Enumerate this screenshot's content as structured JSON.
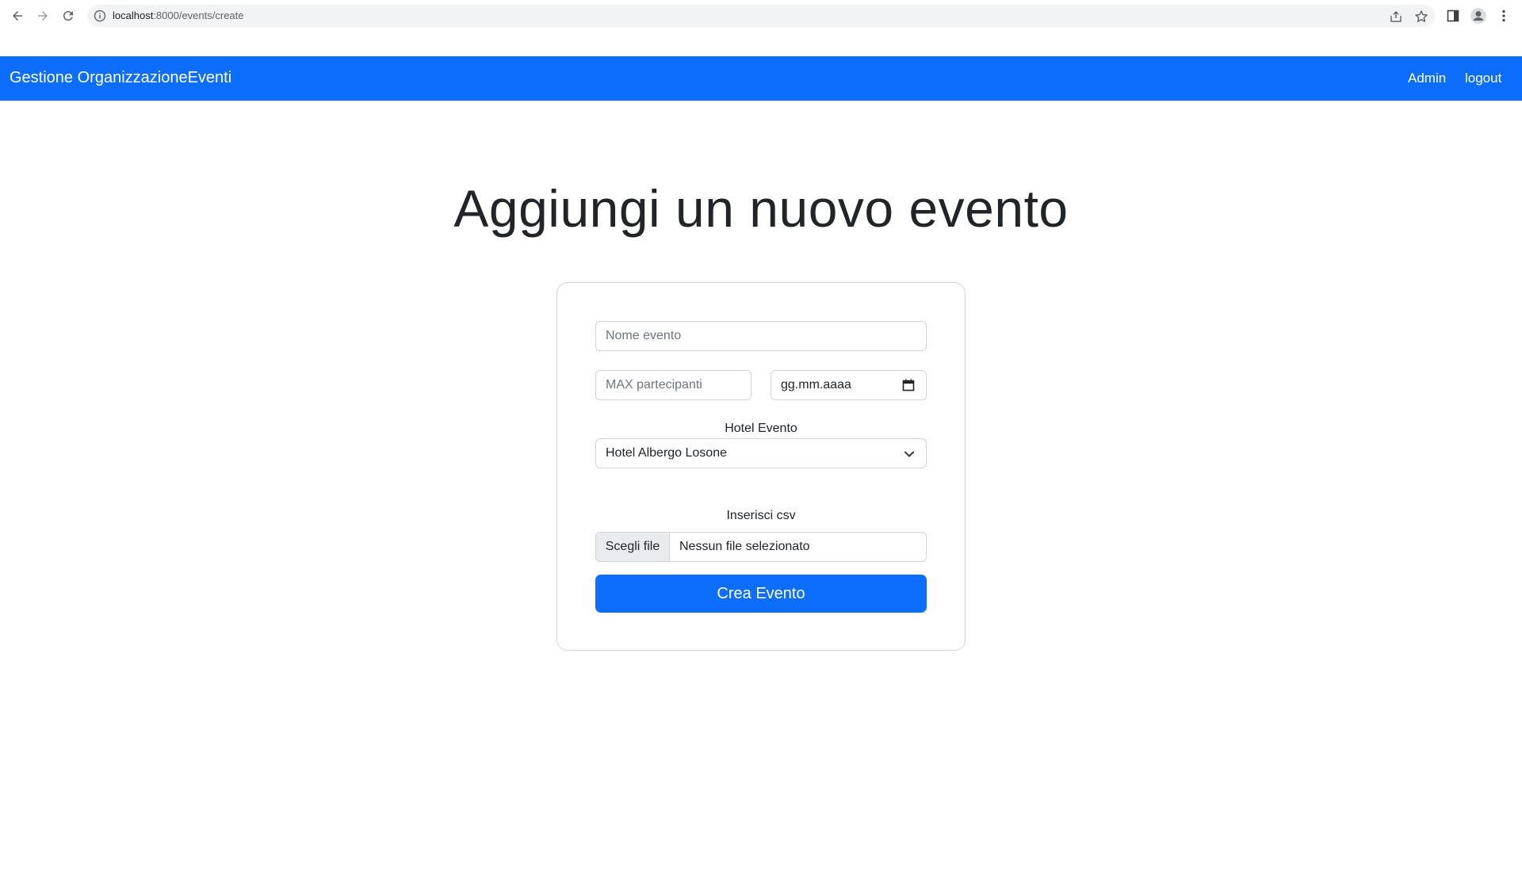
{
  "browser": {
    "url_host": "localhost",
    "url_rest": ":8000/events/create"
  },
  "navbar": {
    "brand": "Gestione OrganizzazioneEventi",
    "links": [
      "Admin",
      "logout"
    ],
    "color": "#0d6efd"
  },
  "page": {
    "title": "Aggiungi un nuovo evento"
  },
  "form": {
    "event_name_placeholder": "Nome evento",
    "max_participants_placeholder": "MAX partecipanti",
    "date_placeholder": "gg.mm.aaaa",
    "hotel_label": "Hotel Evento",
    "hotel_selected": "Hotel Albergo Losone",
    "csv_label": "Inserisci csv",
    "file_button": "Scegli file",
    "file_status": "Nessun file selezionato",
    "submit": "Crea Evento"
  }
}
